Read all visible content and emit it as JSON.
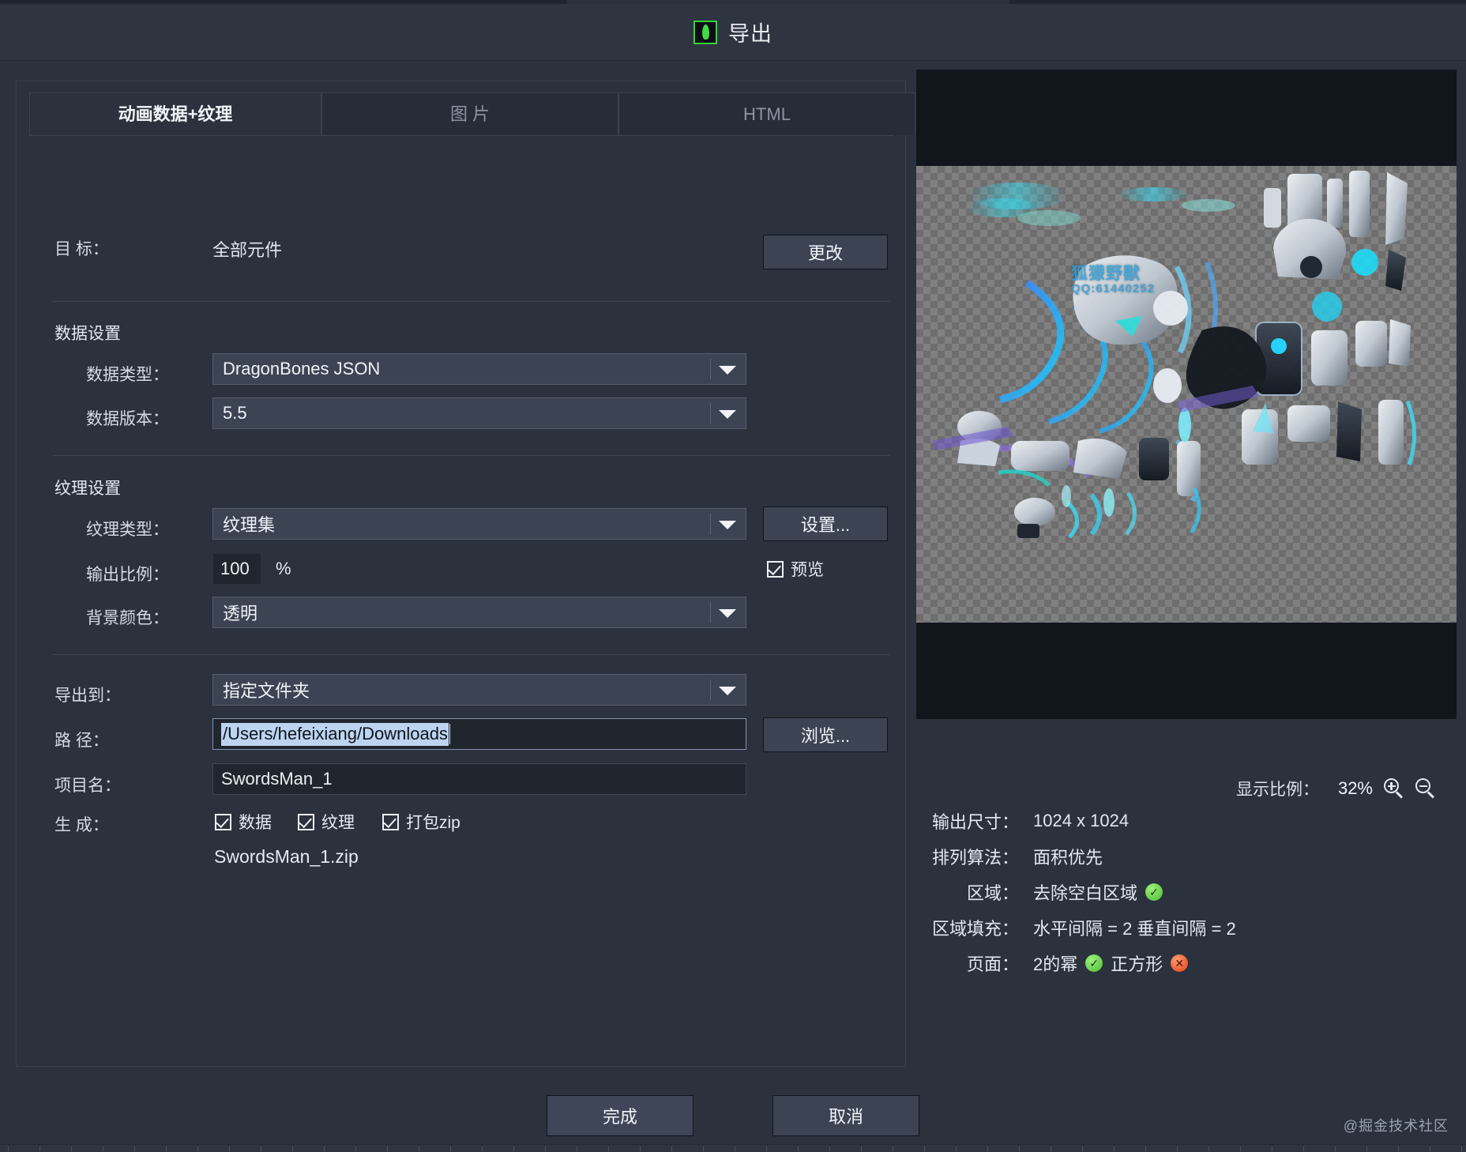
{
  "window": {
    "title": "导出",
    "icon": "dragonbones-icon"
  },
  "tabs": [
    {
      "label": "动画数据+纹理",
      "active": true
    },
    {
      "label": "图 片",
      "active": false
    },
    {
      "label": "HTML",
      "active": false
    }
  ],
  "target": {
    "label": "目  标：",
    "value": "全部元件",
    "change_button": "更改"
  },
  "data_settings": {
    "section_title": "数据设置",
    "data_type": {
      "label": "数据类型：",
      "value": "DragonBones JSON"
    },
    "data_version": {
      "label": "数据版本：",
      "value": "5.5"
    }
  },
  "texture_settings": {
    "section_title": "纹理设置",
    "texture_type": {
      "label": "纹理类型：",
      "value": "纹理集"
    },
    "settings_button": "设置...",
    "output_scale": {
      "label": "输出比例：",
      "value": "100",
      "unit": "%"
    },
    "preview_checkbox": {
      "label": "预览",
      "checked": true
    },
    "background_color": {
      "label": "背景颜色：",
      "value": "透明"
    }
  },
  "export": {
    "export_to": {
      "label": "导出到：",
      "value": "指定文件夹"
    },
    "path": {
      "label": "路 径：",
      "value": "/Users/hefeixiang/Downloads",
      "selected": true
    },
    "browse_button": "浏览...",
    "project_name": {
      "label": "项目名：",
      "value": "SwordsMan_1"
    },
    "generate": {
      "label": "生  成：",
      "options": [
        {
          "label": "数据",
          "checked": true
        },
        {
          "label": "纹理",
          "checked": true
        },
        {
          "label": "打包zip",
          "checked": true
        }
      ]
    },
    "output_file": "SwordsMan_1.zip"
  },
  "preview": {
    "zoom_label": "显示比例：",
    "zoom_value": "32%",
    "zoom_in_icon": "zoom-in-icon",
    "zoom_out_icon": "zoom-out-icon",
    "watermark_line1": "狐獴野獸",
    "watermark_line2": "QQ:61440252"
  },
  "stats": [
    {
      "key": "输出尺寸：",
      "value": "1024 x 1024",
      "badges": []
    },
    {
      "key": "排列算法：",
      "value": "面积优先",
      "badges": []
    },
    {
      "key": "区域：",
      "value": "去除空白区域",
      "badges": [
        {
          "state": "ok",
          "glyph": "✓"
        }
      ]
    },
    {
      "key": "区域填充：",
      "value": "水平间隔 = 2 垂直间隔 = 2",
      "badges": []
    }
  ],
  "page_row": {
    "key": "页面：",
    "item1": "2的幂",
    "item1_state": "ok",
    "item1_glyph": "✓",
    "item2": "正方形",
    "item2_state": "no",
    "item2_glyph": "✕"
  },
  "footer": {
    "done_button": "完成",
    "cancel_button": "取消",
    "watermark": "@掘金技术社区"
  },
  "colors": {
    "accent_green": "#45d945",
    "selection_blue": "#bcd4ef",
    "panel_bg": "#2b313d",
    "field_bg": "#3c4454",
    "input_bg": "#20252e"
  }
}
